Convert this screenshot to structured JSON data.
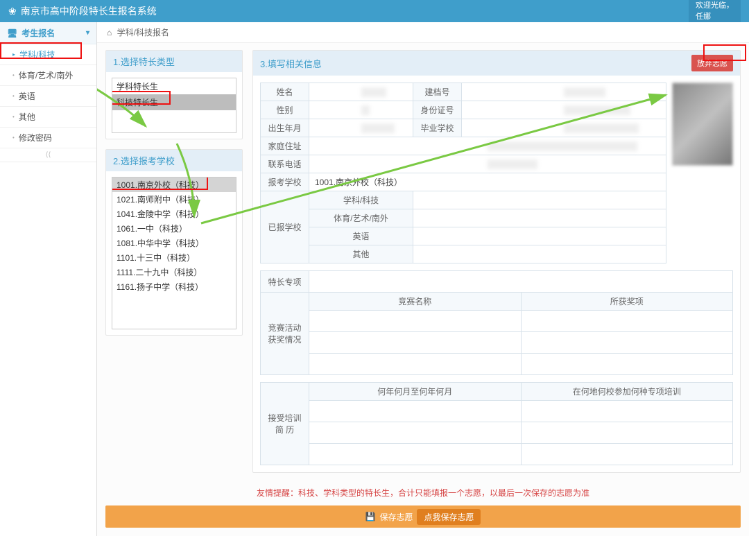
{
  "header": {
    "title": "南京市高中阶段特长生报名系统",
    "welcome": "欢迎光临，",
    "user": "任娜"
  },
  "sidebar": {
    "heading": "考生报名",
    "items": [
      {
        "label": "学科/科技",
        "active": true
      },
      {
        "label": "体育/艺术/南外",
        "active": false
      },
      {
        "label": "英语",
        "active": false
      },
      {
        "label": "其他",
        "active": false
      },
      {
        "label": "修改密码",
        "active": false
      }
    ]
  },
  "breadcrumb": "学科/科技报名",
  "panel1": {
    "title": "1.选择特长类型",
    "options": [
      {
        "label": "学科特长生",
        "selected": false
      },
      {
        "label": "科技特长生",
        "selected": true
      }
    ]
  },
  "panel2": {
    "title": "2.选择报考学校",
    "options": [
      {
        "label": "1001.南京外校（科技）",
        "selected": true
      },
      {
        "label": "1021.南师附中（科技）",
        "selected": false
      },
      {
        "label": "1041.金陵中学（科技）",
        "selected": false
      },
      {
        "label": "1061.一中（科技）",
        "selected": false
      },
      {
        "label": "1081.中华中学（科技）",
        "selected": false
      },
      {
        "label": "1101.十三中（科技）",
        "selected": false
      },
      {
        "label": "1111.二十九中（科技）",
        "selected": false
      },
      {
        "label": "1161.扬子中学（科技）",
        "selected": false
      }
    ]
  },
  "panel3": {
    "title": "3.填写相关信息",
    "abandon": "放弃志愿",
    "labels": {
      "name": "姓名",
      "record": "建档号",
      "gender": "性别",
      "idno": "身份证号",
      "birth": "出生年月",
      "gradschool": "毕业学校",
      "address": "家庭住址",
      "phone": "联系电话",
      "applyschool": "报考学校",
      "applied": "已报学校",
      "cat_subject": "学科/科技",
      "cat_art": "体育/艺术/南外",
      "cat_eng": "英语",
      "cat_other": "其他",
      "specialty": "特长专项",
      "comp_name": "竞赛名称",
      "award": "所获奖项",
      "comp_section": "竞赛活动\n获奖情况",
      "train_period": "何年何月至何年何月",
      "train_where": "在何地何校参加何种专项培训",
      "train_section": "接受培训\n简    历"
    },
    "values": {
      "applyschool": "1001.南京外校（科技）"
    }
  },
  "reminder": "友情提醒：科技、学科类型的特长生，合计只能填报一个志愿，以最后一次保存的志愿为准",
  "savebar": {
    "label": "保存志愿",
    "button": "点我保存志愿"
  }
}
